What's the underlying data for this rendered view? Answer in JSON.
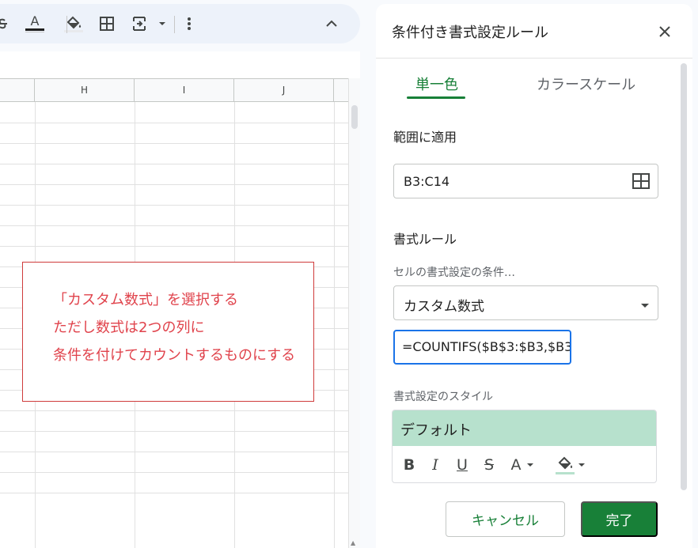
{
  "toolbar": {
    "items": [
      {
        "icon": "strikethrough-icon"
      },
      {
        "icon": "text-color-icon",
        "glyph": "A"
      },
      {
        "icon": "fill-color-icon"
      },
      {
        "icon": "borders-icon"
      },
      {
        "icon": "merge-cells-icon"
      },
      {
        "icon": "more-vert-icon"
      },
      {
        "icon": "chevron-up-icon"
      }
    ],
    "colors": {
      "background": "#edf2fa",
      "icon": "#444746"
    }
  },
  "sheet": {
    "columns": [
      "H",
      "I",
      "J"
    ],
    "row_count": 19
  },
  "callout": {
    "lines": [
      "「カスタム数式」を選択する",
      "ただし数式は2つの列に",
      "条件を付けてカウントするものにする"
    ],
    "colors": {
      "text": "#e0434c",
      "border": "#cf3b3b"
    }
  },
  "panel": {
    "title": "条件付き書式設定ルール",
    "close_icon": "close-icon",
    "tabs": [
      {
        "label": "単一色",
        "active": true
      },
      {
        "label": "カラースケール",
        "active": false
      }
    ],
    "apply_range": {
      "label": "範囲に適用",
      "value": "B3:C14",
      "icon": "select-range-icon"
    },
    "format_rules": {
      "heading": "書式ルール",
      "condition_label": "セルの書式設定の条件…",
      "condition_value": "カスタム数式",
      "formula_value": "=COUNTIFS($B$3:$B3,$B3"
    },
    "style": {
      "label": "書式設定のスタイル",
      "preview_text": "デフォルト",
      "preview_color": "#b7e1cd",
      "tools": [
        {
          "icon": "bold-icon",
          "glyph": "B"
        },
        {
          "icon": "italic-icon",
          "glyph": "I"
        },
        {
          "icon": "underline-icon",
          "glyph": "U"
        },
        {
          "icon": "strikethrough-icon",
          "glyph": "S"
        },
        {
          "icon": "text-color-icon",
          "glyph": "A"
        },
        {
          "icon": "fill-color-icon"
        }
      ]
    },
    "buttons": {
      "cancel": "キャンセル",
      "done": "完了"
    },
    "colors": {
      "accent": "#188038",
      "focus": "#1a73e8"
    }
  }
}
